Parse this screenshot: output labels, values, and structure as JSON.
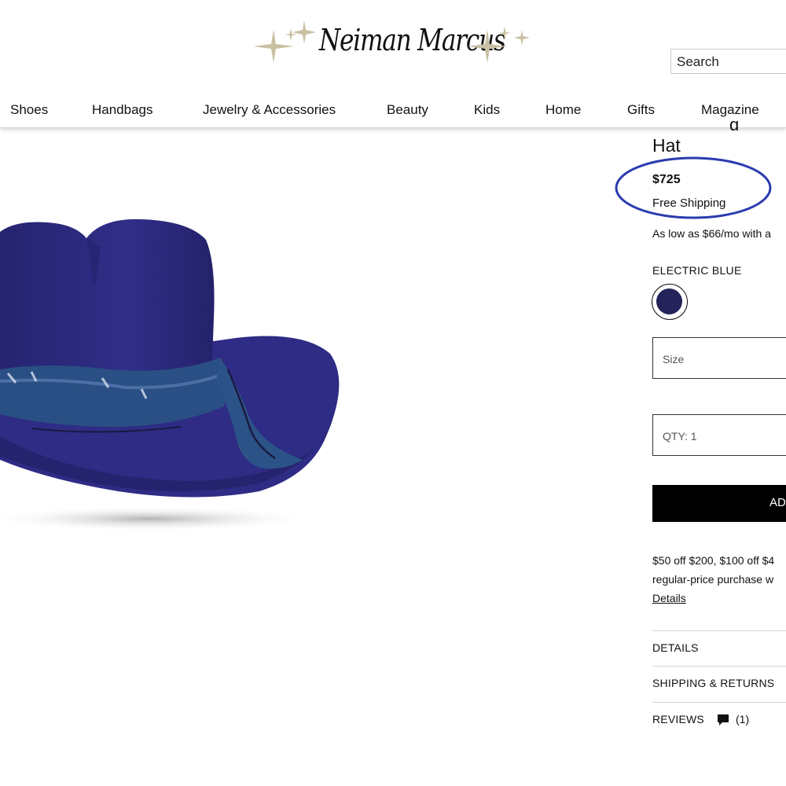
{
  "header": {
    "brand": "Neiman Marcus",
    "search_placeholder": "Search"
  },
  "nav": {
    "items": [
      "Shoes",
      "Handbags",
      "Jewelry & Accessories",
      "Beauty",
      "Kids",
      "Home",
      "Gifts",
      "Magazine"
    ]
  },
  "product": {
    "title_line": "Hat",
    "price": "$725",
    "shipping": "Free Shipping",
    "financing": "As low as $66/mo with a",
    "color_name": "ELECTRIC BLUE",
    "swatch_color": "#24235a",
    "size_placeholder": "Size",
    "qty_label": "QTY: 1",
    "add_to_bag": "AD",
    "promo_line1": "$50 off $200, $100 off $4",
    "promo_line2": "regular-price purchase w",
    "promo_link": "Details"
  },
  "accordion": {
    "details": "DETAILS",
    "shipping_returns": "SHIPPING & RETURNS",
    "reviews": "REVIEWS",
    "review_count": "(1)"
  },
  "colors": {
    "highlight_circle": "#2b3bb0",
    "hat": "#2d2b80",
    "button_bg": "#000000"
  },
  "icons": {
    "sparkle": "sparkle-icon",
    "review": "speech-bubble-icon"
  }
}
